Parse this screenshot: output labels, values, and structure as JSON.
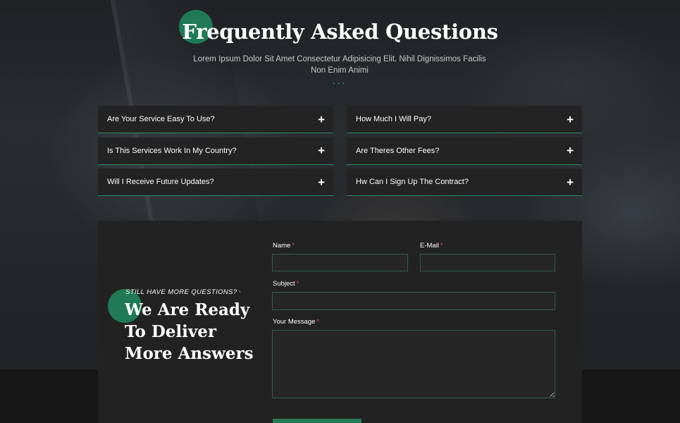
{
  "header": {
    "title": "Frequently Asked Questions",
    "subtitle": "Lorem Ipsum Dolor Sit Amet Consectetur Adipisicing Elit. Nihil Dignissimos Facilis Non Enim Animi",
    "dots": "•••"
  },
  "faq": {
    "left": [
      {
        "question": "Are Your Service Easy To Use?",
        "icon": "+"
      },
      {
        "question": "Is This Services Work In My Country?",
        "icon": "+"
      },
      {
        "question": "Will I Receive Future Updates?",
        "icon": "+"
      }
    ],
    "right": [
      {
        "question": "How Much I Will Pay?",
        "icon": "+"
      },
      {
        "question": "Are Theres Other Fees?",
        "icon": "+"
      },
      {
        "question": "Hw Can I Sign Up The Contract?",
        "icon": "+"
      }
    ]
  },
  "contact": {
    "kicker": "STILL HAVE MORE QUESTIONS?",
    "kicker_dot": "•",
    "heading": "We Are Ready To Deliver More Answers",
    "fields": {
      "name": {
        "label": "Name",
        "required_mark": "*",
        "value": ""
      },
      "email": {
        "label": "E-Mail",
        "required_mark": "*",
        "value": ""
      },
      "subject": {
        "label": "Subject",
        "required_mark": "*",
        "value": ""
      },
      "message": {
        "label": "Your Message",
        "required_mark": "*",
        "value": ""
      }
    }
  },
  "colors": {
    "accent": "#1f7a55",
    "required": "#e2483d",
    "panel": "#222222",
    "faq_item": "#232323"
  }
}
